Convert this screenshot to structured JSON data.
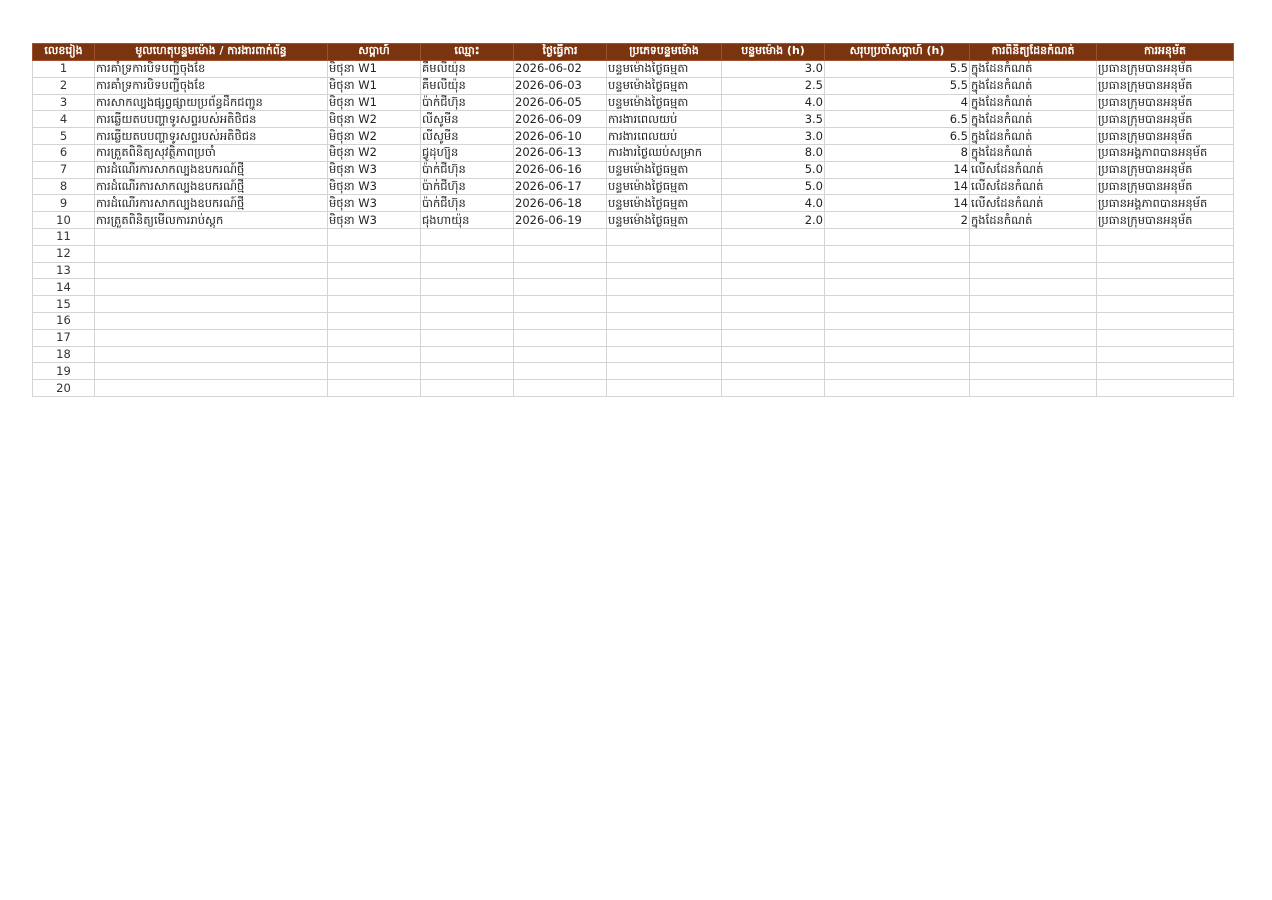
{
  "sheet": {
    "headers": [
      "លេខរៀង",
      "មូលហេតុបន្ទមម៉ោង / ការងារពាក់ព័ន្ធ",
      "សប្ដាហ៍",
      "ឈ្មោះ",
      "ថ្ងៃធ្វើការ",
      "ប្រភេទបន្ទមម៉ោង",
      "បន្ទមម៉ោង (h)",
      "សរុបប្រចាំសប្ដាហ៍ (h)",
      "ការពិនិត្យដែនកំណត់",
      "ការអនុម័ត"
    ],
    "rows": [
      [
        "1",
        "ការគាំទ្រការបិទបញ្ជីចុងខែ",
        "មិថុនា W1",
        "គឹមលីយ៉ុន",
        "2026-06-02",
        "បន្ទមម៉ោងថ្ងៃធម្មតា",
        "3.0",
        "5.5",
        "ក្នុងដែនកំណត់",
        "ប្រធានក្រុមបានអនុម័ត"
      ],
      [
        "2",
        "ការគាំទ្រការបិទបញ្ជីចុងខែ",
        "មិថុនា W1",
        "គឹមលីយ៉ុន",
        "2026-06-03",
        "បន្ទមម៉ោងថ្ងៃធម្មតា",
        "2.5",
        "5.5",
        "ក្នុងដែនកំណត់",
        "ប្រធានក្រុមបានអនុម័ត"
      ],
      [
        "3",
        "ការសាកល្បងផ្សព្វផ្សាយប្រព័ន្ធដឹកជញ្ជូន",
        "មិថុនា W1",
        "ប៉ាក់ជីហ៊ុន",
        "2026-06-05",
        "បន្ទមម៉ោងថ្ងៃធម្មតា",
        "4.0",
        "4",
        "ក្នុងដែនកំណត់",
        "ប្រធានក្រុមបានអនុម័ត"
      ],
      [
        "4",
        "ការឆ្លើយតបបញ្ហាទូរសព្ទរបស់អតិថិជន",
        "មិថុនា W2",
        "លីសូមីន",
        "2026-06-09",
        "ការងារពេលយប់",
        "3.5",
        "6.5",
        "ក្នុងដែនកំណត់",
        "ប្រធានក្រុមបានអនុម័ត"
      ],
      [
        "5",
        "ការឆ្លើយតបបញ្ហាទូរសព្ទរបស់អតិថិជន",
        "មិថុនា W2",
        "លីសូមីន",
        "2026-06-10",
        "ការងារពេលយប់",
        "3.0",
        "6.5",
        "ក្នុងដែនកំណត់",
        "ប្រធានក្រុមបានអនុម័ត"
      ],
      [
        "6",
        "ការត្រួតពិនិត្យសុវត្ថិភាពប្រចាំ",
        "មិថុនា W2",
        "ជ្វូដុហ្យ៊ុន",
        "2026-06-13",
        "ការងារថ្ងៃឈប់សម្រាក",
        "8.0",
        "8",
        "ក្នុងដែនកំណត់",
        "ប្រធានអង្គភាពបានអនុម័ត"
      ],
      [
        "7",
        "ការដំណើរការសាកល្បងឧបករណ៍ថ្មី",
        "មិថុនា W3",
        "ប៉ាក់ជីហ៊ុន",
        "2026-06-16",
        "បន្ទមម៉ោងថ្ងៃធម្មតា",
        "5.0",
        "14",
        "លើសដែនកំណត់",
        "ប្រធានក្រុមបានអនុម័ត"
      ],
      [
        "8",
        "ការដំណើរការសាកល្បងឧបករណ៍ថ្មី",
        "មិថុនា W3",
        "ប៉ាក់ជីហ៊ុន",
        "2026-06-17",
        "បន្ទមម៉ោងថ្ងៃធម្មតា",
        "5.0",
        "14",
        "លើសដែនកំណត់",
        "ប្រធានក្រុមបានអនុម័ត"
      ],
      [
        "9",
        "ការដំណើរការសាកល្បងឧបករណ៍ថ្មី",
        "មិថុនា W3",
        "ប៉ាក់ជីហ៊ុន",
        "2026-06-18",
        "បន្ទមម៉ោងថ្ងៃធម្មតា",
        "4.0",
        "14",
        "លើសដែនកំណត់",
        "ប្រធានអង្គភាពបានអនុម័ត"
      ],
      [
        "10",
        "ការត្រួតពិនិត្យមើលការរាប់ស្តុក",
        "មិថុនា W3",
        "ជុងហាយ៉ុន",
        "2026-06-19",
        "បន្ទមម៉ោងថ្ងៃធម្មតា",
        "2.0",
        "2",
        "ក្នុងដែនកំណត់",
        "ប្រធានក្រុមបានអនុម័ត"
      ],
      [
        "11",
        "",
        "",
        "",
        "",
        "",
        "",
        "",
        "",
        ""
      ],
      [
        "12",
        "",
        "",
        "",
        "",
        "",
        "",
        "",
        "",
        ""
      ],
      [
        "13",
        "",
        "",
        "",
        "",
        "",
        "",
        "",
        "",
        ""
      ],
      [
        "14",
        "",
        "",
        "",
        "",
        "",
        "",
        "",
        "",
        ""
      ],
      [
        "15",
        "",
        "",
        "",
        "",
        "",
        "",
        "",
        "",
        ""
      ],
      [
        "16",
        "",
        "",
        "",
        "",
        "",
        "",
        "",
        "",
        ""
      ],
      [
        "17",
        "",
        "",
        "",
        "",
        "",
        "",
        "",
        "",
        ""
      ],
      [
        "18",
        "",
        "",
        "",
        "",
        "",
        "",
        "",
        "",
        ""
      ],
      [
        "19",
        "",
        "",
        "",
        "",
        "",
        "",
        "",
        "",
        ""
      ],
      [
        "20",
        "",
        "",
        "",
        "",
        "",
        "",
        "",
        "",
        ""
      ]
    ]
  },
  "colors": {
    "header_bg": "#7b3410",
    "header_text": "#ffffff",
    "grid_line": "#d4d4d4"
  }
}
